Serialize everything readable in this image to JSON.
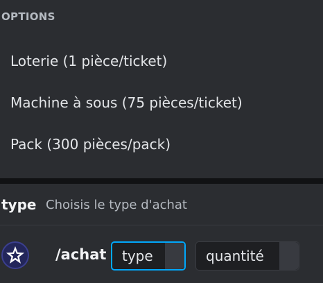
{
  "autocomplete": {
    "header": "OPTIONS",
    "options": [
      {
        "label": "Loterie (1 pièce/ticket)"
      },
      {
        "label": "Machine à sous (75 pièces/ticket)"
      },
      {
        "label": "Pack (300 pièces/pack)"
      }
    ]
  },
  "parameter": {
    "name": "type",
    "description": "Choisis le type d'achat"
  },
  "command": {
    "name": "/achat",
    "avatar_icon": "star-logo-icon",
    "options": [
      {
        "label": "type",
        "active": true
      },
      {
        "label": "quantité",
        "active": false
      }
    ]
  },
  "colors": {
    "background": "#2b2d31",
    "chip_background": "#1e1f22",
    "focus_border": "#00a8fc",
    "avatar_background": "#23265a"
  }
}
